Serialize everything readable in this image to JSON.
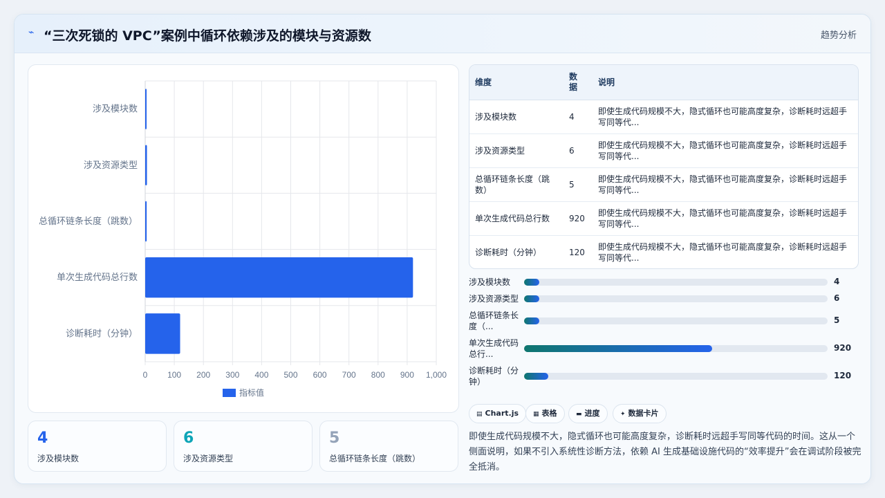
{
  "header": {
    "icon": "zigzag-icon",
    "title": "“三次死锁的 VPC”案例中循环依赖涉及的模块与资源数",
    "tag": "趋势分析"
  },
  "chart_data": {
    "type": "bar",
    "orientation": "horizontal",
    "categories": [
      "涉及模块数",
      "涉及资源类型",
      "总循环链条长度（跳数）",
      "单次生成代码总行数",
      "诊断耗时（分钟）"
    ],
    "series": [
      {
        "name": "指标值",
        "values": [
          4,
          6,
          5,
          920,
          120
        ],
        "color": "#2563eb"
      }
    ],
    "xlim": [
      0,
      1000
    ],
    "xticks": [
      "0",
      "100",
      "200",
      "300",
      "400",
      "500",
      "600",
      "700",
      "800",
      "900",
      "1,000"
    ],
    "grid": true,
    "legend_position": "bottom"
  },
  "stats": [
    {
      "value": "4",
      "label": "涉及模块数",
      "color": "#2563eb"
    },
    {
      "value": "6",
      "label": "涉及资源类型",
      "color": "#0ea5b7"
    },
    {
      "value": "5",
      "label": "总循环链条长度（跳数）",
      "color": "#94a3b8"
    }
  ],
  "table": {
    "headers": [
      "维度",
      "数据",
      "说明"
    ],
    "rows": [
      {
        "dim": "涉及模块数",
        "val": "4",
        "desc": "即使生成代码规模不大，隐式循环也可能高度复杂，诊断耗时远超手写同等代..."
      },
      {
        "dim": "涉及资源类型",
        "val": "6",
        "desc": "即使生成代码规模不大，隐式循环也可能高度复杂，诊断耗时远超手写同等代..."
      },
      {
        "dim": "总循环链条长度（跳数）",
        "val": "5",
        "desc": "即使生成代码规模不大，隐式循环也可能高度复杂，诊断耗时远超手写同等代..."
      },
      {
        "dim": "单次生成代码总行数",
        "val": "920",
        "desc": "即使生成代码规模不大，隐式循环也可能高度复杂，诊断耗时远超手写同等代..."
      },
      {
        "dim": "诊断耗时（分钟）",
        "val": "120",
        "desc": "即使生成代码规模不大，隐式循环也可能高度复杂，诊断耗时远超手写同等代..."
      }
    ]
  },
  "progress": [
    {
      "label": "涉及模块数",
      "value": "4",
      "fraction": 0.05
    },
    {
      "label": "涉及资源类型",
      "value": "6",
      "fraction": 0.05
    },
    {
      "label": "总循环链条长度（...",
      "value": "5",
      "fraction": 0.05
    },
    {
      "label": "单次生成代码总行...",
      "value": "920",
      "fraction": 0.62
    },
    {
      "label": "诊断耗时（分钟）",
      "value": "120",
      "fraction": 0.08
    }
  ],
  "chips": [
    {
      "icon": "chart-icon",
      "glyph": "▤",
      "label": "Chart.js"
    },
    {
      "icon": "table-icon",
      "glyph": "▦",
      "label": "表格"
    },
    {
      "icon": "progress-icon",
      "glyph": "▬",
      "label": "进度"
    },
    {
      "icon": "card-icon",
      "glyph": "✦",
      "label": "数据卡片"
    }
  ],
  "summary": "即使生成代码规模不大，隐式循环也可能高度复杂，诊断耗时远超手写同等代码的时间。这从一个侧面说明，如果不引入系统性诊断方法，依赖 AI 生成基础设施代码的“效率提升”会在调试阶段被完全抵消。"
}
